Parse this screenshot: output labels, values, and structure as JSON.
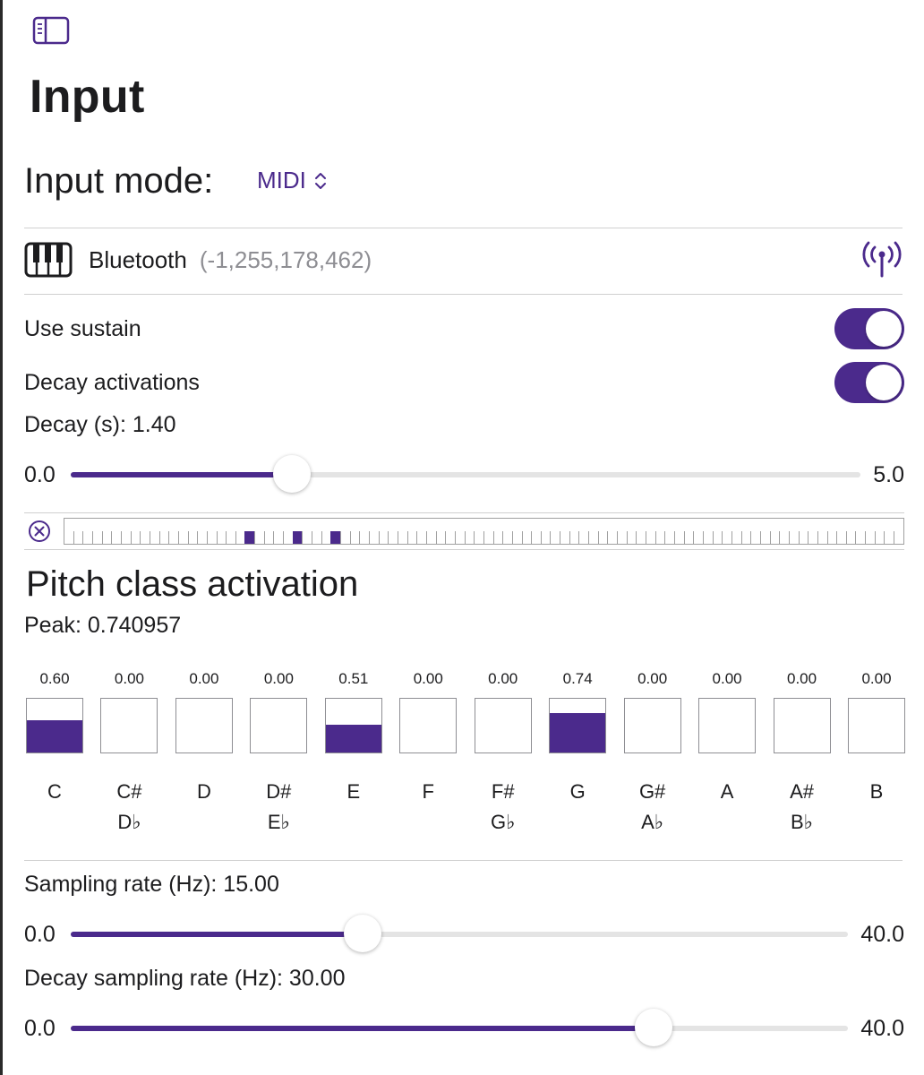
{
  "sidebar_toggle": {
    "icon": "sidebar-icon"
  },
  "page_title": "Input",
  "input_mode": {
    "label": "Input mode:",
    "value": "MIDI",
    "icon": "chevron-up-down-icon"
  },
  "device": {
    "icon": "piano-keyboard-icon",
    "name": "Bluetooth",
    "id": "(-1,255,178,462)",
    "status_icon": "antenna-broadcast-icon"
  },
  "use_sustain": {
    "label": "Use sustain",
    "on": true
  },
  "decay_activations": {
    "label": "Decay activations",
    "on": true
  },
  "decay": {
    "label": "Decay (s): 1.40",
    "min": "0.0",
    "max": "5.0",
    "value": 1.4,
    "range": [
      0,
      5
    ]
  },
  "mini_keyboard": {
    "clear_icon": "clear-circle-x-icon",
    "key_count": 88,
    "active_keys": [
      19,
      24,
      28
    ]
  },
  "pitch_class": {
    "title": "Pitch class activation",
    "peak_label": "Peak: 0.740957",
    "items": [
      {
        "value": "0.60",
        "level": 0.6,
        "name": [
          "C"
        ]
      },
      {
        "value": "0.00",
        "level": 0.0,
        "name": [
          "C#",
          "D♭"
        ]
      },
      {
        "value": "0.00",
        "level": 0.0,
        "name": [
          "D"
        ]
      },
      {
        "value": "0.00",
        "level": 0.0,
        "name": [
          "D#",
          "E♭"
        ]
      },
      {
        "value": "0.51",
        "level": 0.51,
        "name": [
          "E"
        ]
      },
      {
        "value": "0.00",
        "level": 0.0,
        "name": [
          "F"
        ]
      },
      {
        "value": "0.00",
        "level": 0.0,
        "name": [
          "F#",
          "G♭"
        ]
      },
      {
        "value": "0.74",
        "level": 0.74,
        "name": [
          "G"
        ]
      },
      {
        "value": "0.00",
        "level": 0.0,
        "name": [
          "G#",
          "A♭"
        ]
      },
      {
        "value": "0.00",
        "level": 0.0,
        "name": [
          "A"
        ]
      },
      {
        "value": "0.00",
        "level": 0.0,
        "name": [
          "A#",
          "B♭"
        ]
      },
      {
        "value": "0.00",
        "level": 0.0,
        "name": [
          "B"
        ]
      }
    ]
  },
  "sampling_rate": {
    "label": "Sampling rate (Hz): 15.00",
    "min": "0.0",
    "max": "40.0",
    "value": 15,
    "range": [
      0,
      40
    ]
  },
  "decay_sampling_rate": {
    "label": "Decay sampling rate (Hz): 30.00",
    "min": "0.0",
    "max": "40.0",
    "value": 30,
    "range": [
      0,
      40
    ]
  },
  "colors": {
    "accent": "#4b2a8c",
    "secondary_text": "#8e8e93",
    "divider": "#d0d0d0"
  }
}
